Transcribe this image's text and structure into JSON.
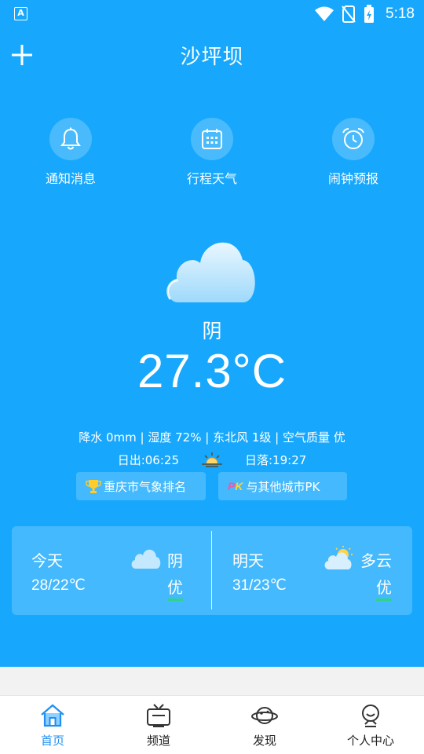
{
  "status_bar": {
    "app_icon_letter": "A",
    "time": "5:18"
  },
  "header": {
    "city": "沙坪坝"
  },
  "quick_actions": [
    {
      "label": "通知消息",
      "icon": "bell-icon"
    },
    {
      "label": "行程天气",
      "icon": "calendar-icon"
    },
    {
      "label": "闹钟预报",
      "icon": "alarm-clock-icon"
    }
  ],
  "current": {
    "condition": "阴",
    "temperature": "27.3°C",
    "details": "降水 0mm | 湿度 72% | 东北风 1级 | 空气质量 优",
    "sunrise": "日出:06:25",
    "sunset": "日落:19:27",
    "rank_link": "重庆市气象排名",
    "pk_link": "与其他城市PK",
    "pk_badge_p": "P",
    "pk_badge_k": "K"
  },
  "forecast": {
    "today": {
      "day": "今天",
      "range": "28/22℃",
      "condition": "阴",
      "aqi": "优"
    },
    "tomorrow": {
      "day": "明天",
      "range": "31/23℃",
      "condition": "多云",
      "aqi": "优"
    }
  },
  "bottom_nav": [
    {
      "label": "首页",
      "icon": "home-icon",
      "active": true
    },
    {
      "label": "频道",
      "icon": "tv-icon",
      "active": false
    },
    {
      "label": "发现",
      "icon": "planet-icon",
      "active": false
    },
    {
      "label": "个人中心",
      "icon": "user-icon",
      "active": false
    }
  ],
  "colors": {
    "background": "#17a8fd",
    "active_tab": "#1f8ff2",
    "aqi_good": "#2fd48b"
  }
}
